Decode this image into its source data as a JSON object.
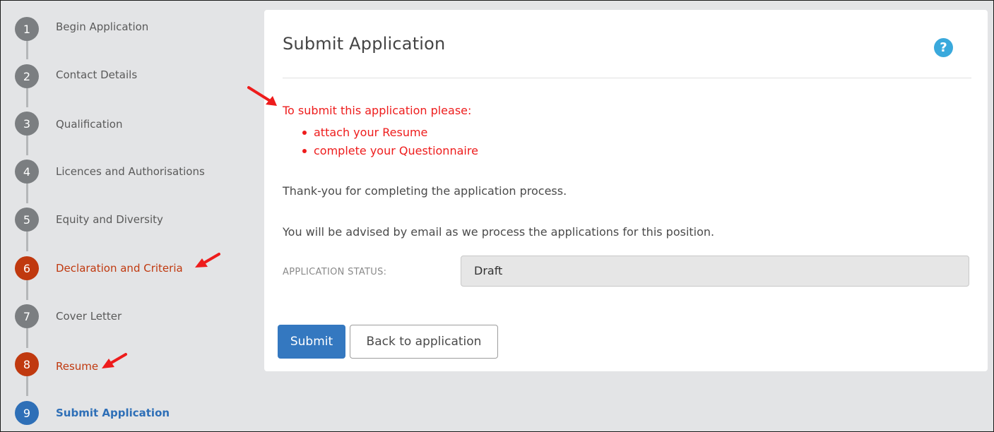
{
  "steps": [
    {
      "number": "1",
      "label": "Begin Application",
      "state": "default"
    },
    {
      "number": "2",
      "label": "Contact Details",
      "state": "default"
    },
    {
      "number": "3",
      "label": "Qualification",
      "state": "default"
    },
    {
      "number": "4",
      "label": "Licences and Authorisations",
      "state": "default"
    },
    {
      "number": "5",
      "label": "Equity and Diversity",
      "state": "default"
    },
    {
      "number": "6",
      "label": "Declaration and Criteria",
      "state": "incomplete"
    },
    {
      "number": "7",
      "label": "Cover Letter",
      "state": "default"
    },
    {
      "number": "8",
      "label": "Resume",
      "state": "incomplete"
    },
    {
      "number": "9",
      "label": "Submit Application",
      "state": "active"
    }
  ],
  "panel": {
    "title": "Submit Application",
    "help_icon": "question-circle-icon",
    "warning": {
      "heading": "To submit this application please:",
      "items": [
        "attach your Resume",
        "complete your Questionnaire"
      ]
    },
    "thanks_text": "Thank-you for completing the application process.",
    "advise_text": "You will be advised by email as we process the applications for this position.",
    "status_label": "APPLICATION STATUS:",
    "status_value": "Draft",
    "submit_label": "Submit",
    "back_label": "Back to application"
  },
  "colors": {
    "step_default": "#7b7e81",
    "step_incomplete": "#c0390f",
    "step_active": "#2e6fb7",
    "warning_text": "#ee1c1c",
    "help_icon": "#3aa9dc",
    "submit_button": "#3478c0",
    "annotation_arrow": "#ee1c1c"
  },
  "annotations": [
    "arrow-icon",
    "arrow-icon",
    "arrow-icon"
  ]
}
